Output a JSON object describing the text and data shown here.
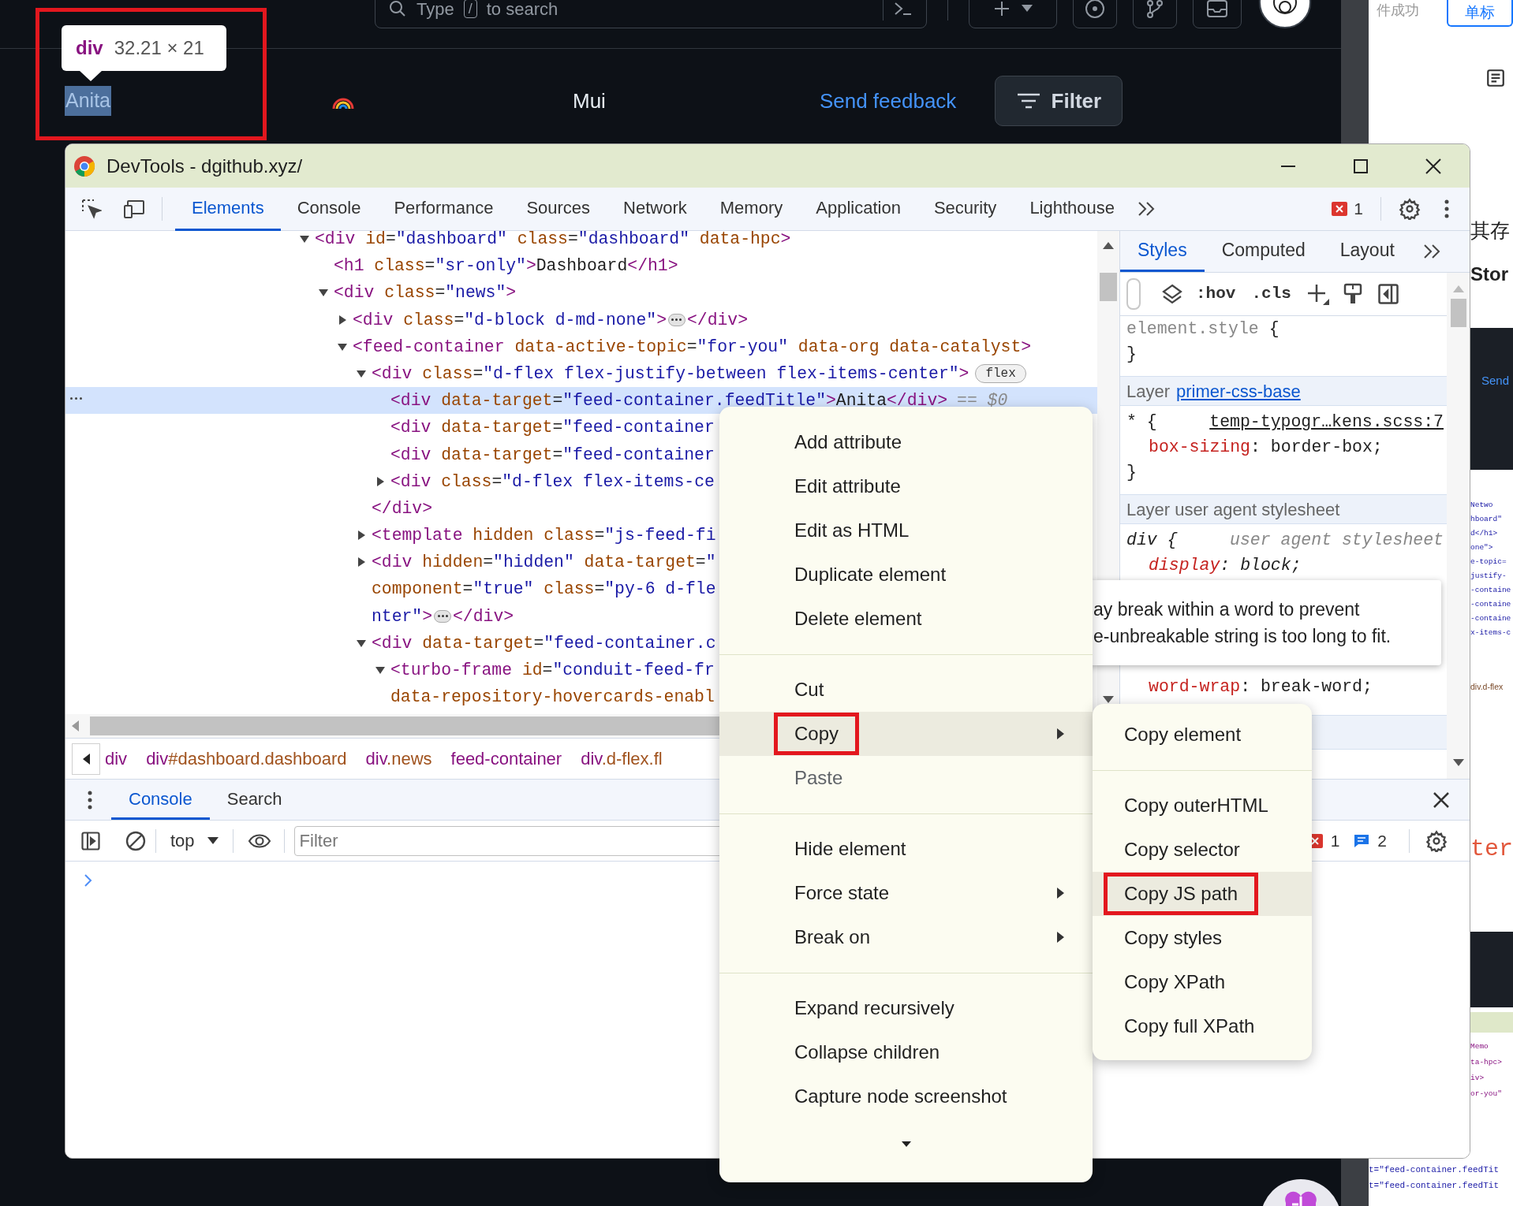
{
  "page": {
    "search": {
      "placeholder": "Type",
      "shortcut_key": "/",
      "placeholder_suffix": "to search"
    },
    "feed_title": {
      "text": "Anita",
      "highlighted": true,
      "annotated": true
    },
    "inspect_tooltip": {
      "tag": "div",
      "size": "32.21 × 21"
    },
    "center_label": "Mui",
    "feedback_link": "Send feedback",
    "filter_button": "Filter"
  },
  "background_page": {
    "top_text": "件成功",
    "top_button": "单标",
    "heading_1": "其存",
    "heading_2": "Stor",
    "link": "Send",
    "code_fragment": "ter",
    "mini_lines_upper": [
      "Netwo",
      "hboard\"",
      "d</h1>",
      "one\">",
      "e-topic=",
      "justify-",
      "-containe",
      "-containe",
      "-containe",
      "x-items-c"
    ],
    "mini_breadcrumb": "div.d-flex",
    "mini_lines_lower": [
      "Memo",
      "ta-hpc>",
      "iv>",
      "or-you\""
    ],
    "mini_lines_bottom": [
      "t=\"feed-container.feedTit",
      "t=\"feed-container.feedTit"
    ]
  },
  "devtools": {
    "title": "DevTools - dgithub.xyz/",
    "tabs": [
      {
        "label": "Elements",
        "selected": true
      },
      {
        "label": "Console",
        "selected": false
      },
      {
        "label": "Performance",
        "selected": false
      },
      {
        "label": "Sources",
        "selected": false
      },
      {
        "label": "Network",
        "selected": false
      },
      {
        "label": "Memory",
        "selected": false
      },
      {
        "label": "Application",
        "selected": false
      },
      {
        "label": "Security",
        "selected": false
      },
      {
        "label": "Lighthouse",
        "selected": false
      }
    ],
    "error_count": "1",
    "dom_tree": [
      {
        "lines": [
          [
            {
              "kind": "tag",
              "text": "<div"
            },
            {
              "kind": "attr",
              "text": " id"
            },
            {
              "kind": "txt",
              "text": "="
            },
            {
              "kind": "val",
              "text": "\"dashboard\""
            },
            {
              "kind": "attr",
              "text": " class"
            },
            {
              "kind": "txt",
              "text": "="
            },
            {
              "kind": "val",
              "text": "\"dashboard\""
            },
            {
              "kind": "attr",
              "text": " data-hpc"
            },
            {
              "kind": "tag",
              "text": ">"
            }
          ]
        ],
        "expanded": true,
        "selected": false,
        "children": [
          {
            "lines": [
              [
                {
                  "kind": "tag",
                  "text": "<h1"
                },
                {
                  "kind": "attr",
                  "text": " class"
                },
                {
                  "kind": "txt",
                  "text": "="
                },
                {
                  "kind": "val",
                  "text": "\"sr-only\""
                },
                {
                  "kind": "tag",
                  "text": ">"
                },
                {
                  "kind": "txt",
                  "text": "Dashboard"
                },
                {
                  "kind": "tag",
                  "text": "</h1>"
                }
              ]
            ],
            "selected": false
          },
          {
            "lines": [
              [
                {
                  "kind": "tag",
                  "text": "<div"
                },
                {
                  "kind": "attr",
                  "text": " class"
                },
                {
                  "kind": "txt",
                  "text": "="
                },
                {
                  "kind": "val",
                  "text": "\"news\""
                },
                {
                  "kind": "tag",
                  "text": ">"
                }
              ]
            ],
            "expanded": true,
            "selected": false,
            "children": [
              {
                "lines": [
                  [
                    {
                      "kind": "tag",
                      "text": "<div"
                    },
                    {
                      "kind": "attr",
                      "text": " class"
                    },
                    {
                      "kind": "txt",
                      "text": "="
                    },
                    {
                      "kind": "val",
                      "text": "\"d-block d-md-none\""
                    },
                    {
                      "kind": "tag",
                      "text": ">"
                    },
                    {
                      "kind": "more"
                    },
                    {
                      "kind": "tag",
                      "text": "</div>"
                    }
                  ]
                ],
                "expanded": false,
                "selected": false
              },
              {
                "lines": [
                  [
                    {
                      "kind": "tag",
                      "text": "<feed-container"
                    },
                    {
                      "kind": "attr",
                      "text": " data-active-topic"
                    },
                    {
                      "kind": "txt",
                      "text": "="
                    },
                    {
                      "kind": "val",
                      "text": "\"for-you\""
                    },
                    {
                      "kind": "attr",
                      "text": " data-org"
                    },
                    {
                      "kind": "attr",
                      "text": " data-catalyst"
                    },
                    {
                      "kind": "tag",
                      "text": ">"
                    }
                  ]
                ],
                "expanded": true,
                "selected": false,
                "children": [
                  {
                    "lines": [
                      [
                        {
                          "kind": "tag",
                          "text": "<div"
                        },
                        {
                          "kind": "attr",
                          "text": " class"
                        },
                        {
                          "kind": "txt",
                          "text": "="
                        },
                        {
                          "kind": "val",
                          "text": "\"d-flex flex-justify-between flex-items-center\""
                        },
                        {
                          "kind": "tag",
                          "text": ">"
                        },
                        {
                          "kind": "badge",
                          "text": "flex"
                        }
                      ]
                    ],
                    "expanded": true,
                    "selected": false,
                    "closing": [
                      {
                        "kind": "tag",
                        "text": "</div>"
                      }
                    ],
                    "children": [
                      {
                        "lines": [
                          [
                            {
                              "kind": "tag",
                              "text": "<div"
                            },
                            {
                              "kind": "attr",
                              "text": " data-target"
                            },
                            {
                              "kind": "txt",
                              "text": "="
                            },
                            {
                              "kind": "val",
                              "text": "\"feed-container.feedTitle\""
                            },
                            {
                              "kind": "tag",
                              "text": ">"
                            },
                            {
                              "kind": "txt",
                              "text": "Anita"
                            },
                            {
                              "kind": "tag",
                              "text": "</div>"
                            },
                            {
                              "kind": "ref",
                              "text": "== $0"
                            }
                          ]
                        ],
                        "selected": true
                      },
                      {
                        "lines": [
                          [
                            {
                              "kind": "tag",
                              "text": "<div"
                            },
                            {
                              "kind": "attr",
                              "text": " data-target"
                            },
                            {
                              "kind": "txt",
                              "text": "="
                            },
                            {
                              "kind": "val",
                              "text": "\"feed-container"
                            }
                          ]
                        ],
                        "selected": false
                      },
                      {
                        "lines": [
                          [
                            {
                              "kind": "tag",
                              "text": "<div"
                            },
                            {
                              "kind": "attr",
                              "text": " data-target"
                            },
                            {
                              "kind": "txt",
                              "text": "="
                            },
                            {
                              "kind": "val",
                              "text": "\"feed-container"
                            }
                          ]
                        ],
                        "selected": false
                      },
                      {
                        "lines": [
                          [
                            {
                              "kind": "tag",
                              "text": "<div"
                            },
                            {
                              "kind": "attr",
                              "text": " class"
                            },
                            {
                              "kind": "txt",
                              "text": "="
                            },
                            {
                              "kind": "val",
                              "text": "\"d-flex flex-items-ce"
                            }
                          ]
                        ],
                        "expanded": false,
                        "selected": false
                      }
                    ]
                  },
                  {
                    "lines": [
                      [
                        {
                          "kind": "tag",
                          "text": "<template"
                        },
                        {
                          "kind": "attr",
                          "text": " hidden"
                        },
                        {
                          "kind": "attr",
                          "text": " class"
                        },
                        {
                          "kind": "txt",
                          "text": "="
                        },
                        {
                          "kind": "val",
                          "text": "\"js-feed-fi"
                        }
                      ]
                    ],
                    "expanded": false,
                    "selected": false
                  },
                  {
                    "lines": [
                      [
                        {
                          "kind": "tag",
                          "text": "<div"
                        },
                        {
                          "kind": "attr",
                          "text": " hidden"
                        },
                        {
                          "kind": "txt",
                          "text": "="
                        },
                        {
                          "kind": "val",
                          "text": "\"hidden\""
                        },
                        {
                          "kind": "attr",
                          "text": " data-target"
                        },
                        {
                          "kind": "txt",
                          "text": "="
                        },
                        {
                          "kind": "val",
                          "text": "\""
                        }
                      ],
                      [
                        {
                          "kind": "attr",
                          "text": "component"
                        },
                        {
                          "kind": "txt",
                          "text": "="
                        },
                        {
                          "kind": "val",
                          "text": "\"true\""
                        },
                        {
                          "kind": "attr",
                          "text": " class"
                        },
                        {
                          "kind": "txt",
                          "text": "="
                        },
                        {
                          "kind": "val",
                          "text": "\"py-6 d-fle"
                        }
                      ],
                      [
                        {
                          "kind": "val",
                          "text": "nter\""
                        },
                        {
                          "kind": "tag",
                          "text": ">"
                        },
                        {
                          "kind": "more"
                        },
                        {
                          "kind": "tag",
                          "text": "</div>"
                        }
                      ]
                    ],
                    "expanded": false,
                    "selected": false
                  },
                  {
                    "lines": [
                      [
                        {
                          "kind": "tag",
                          "text": "<div"
                        },
                        {
                          "kind": "attr",
                          "text": " data-target"
                        },
                        {
                          "kind": "txt",
                          "text": "="
                        },
                        {
                          "kind": "val",
                          "text": "\"feed-container.c"
                        }
                      ]
                    ],
                    "expanded": true,
                    "selected": false,
                    "children": [
                      {
                        "lines": [
                          [
                            {
                              "kind": "tag",
                              "text": "<turbo-frame"
                            },
                            {
                              "kind": "attr",
                              "text": " id"
                            },
                            {
                              "kind": "txt",
                              "text": "="
                            },
                            {
                              "kind": "val",
                              "text": "\"conduit-feed-fr"
                            }
                          ],
                          [
                            {
                              "kind": "attr",
                              "text": "data-repository-hovercards-enabl"
                            }
                          ]
                        ],
                        "expanded": true,
                        "selected": false
                      }
                    ]
                  }
                ]
              }
            ]
          }
        ]
      }
    ],
    "breadcrumbs": [
      {
        "tag": "div"
      },
      {
        "tag": "div",
        "suffix": "#dashboard.dashboard"
      },
      {
        "tag": "div",
        "suffix": ".news"
      },
      {
        "tag": "feed-container"
      },
      {
        "tag": "div",
        "suffix": ".d-flex.fl"
      }
    ],
    "styles_tabs": [
      {
        "label": "Styles",
        "selected": true
      },
      {
        "label": "Computed",
        "selected": false
      },
      {
        "label": "Layout",
        "selected": false
      }
    ],
    "styles_toolbar": {
      "hover_toggle": ":hov",
      "class_toggle": ".cls"
    },
    "rules_upper": [
      {
        "kind": "selector",
        "parts": [
          {
            "kind": "muted",
            "text": "element.style"
          },
          {
            "kind": "plain",
            "text": " {"
          }
        ]
      },
      {
        "kind": "close",
        "text": "}"
      },
      {
        "kind": "layer",
        "label": "Layer",
        "link": "primer-css-base"
      },
      {
        "kind": "selector",
        "parts": [
          {
            "kind": "plain",
            "text": "* {"
          }
        ],
        "source": "temp-typogr…kens.scss:7"
      },
      {
        "kind": "prop",
        "name": "box-sizing",
        "value": ": border-box;"
      },
      {
        "kind": "close",
        "text": "}"
      },
      {
        "kind": "layer",
        "label": "Layer user agent stylesheet"
      },
      {
        "kind": "selector",
        "parts": [
          {
            "kind": "italic",
            "text": "div {"
          }
        ],
        "source_note": "user agent stylesheet"
      },
      {
        "kind": "prop",
        "name": "display",
        "value": ": block;",
        "italic": true
      }
    ],
    "rules_lower": [
      {
        "kind": "prop",
        "name": "word-wrap",
        "value": ": break-word;"
      }
    ],
    "console": {
      "tabs": [
        {
          "label": "Console",
          "selected": true
        },
        {
          "label": "Search",
          "selected": false
        }
      ],
      "context": "top",
      "filter_placeholder": "Filter",
      "errors": "1",
      "messages": "2"
    }
  },
  "style_tooltip": {
    "lines": [
      "ay break within a word to prevent",
      "e-unbreakable string is too long to fit."
    ]
  },
  "context_menu": {
    "items": [
      {
        "kind": "item",
        "label": "Add attribute",
        "selected": false,
        "disabled": false,
        "has_submenu": false,
        "annotated": false
      },
      {
        "kind": "item",
        "label": "Edit attribute",
        "selected": false,
        "disabled": false,
        "has_submenu": false,
        "annotated": false
      },
      {
        "kind": "item",
        "label": "Edit as HTML",
        "selected": false,
        "disabled": false,
        "has_submenu": false,
        "annotated": false
      },
      {
        "kind": "item",
        "label": "Duplicate element",
        "selected": false,
        "disabled": false,
        "has_submenu": false,
        "annotated": false
      },
      {
        "kind": "item",
        "label": "Delete element",
        "selected": false,
        "disabled": false,
        "has_submenu": false,
        "annotated": false
      },
      {
        "kind": "separator"
      },
      {
        "kind": "item",
        "label": "Cut",
        "selected": false,
        "disabled": false,
        "has_submenu": false,
        "annotated": false
      },
      {
        "kind": "item",
        "label": "Copy",
        "selected": true,
        "disabled": false,
        "has_submenu": true,
        "annotated": true
      },
      {
        "kind": "item",
        "label": "Paste",
        "selected": false,
        "disabled": true,
        "has_submenu": false,
        "annotated": false
      },
      {
        "kind": "separator"
      },
      {
        "kind": "item",
        "label": "Hide element",
        "selected": false,
        "disabled": false,
        "has_submenu": false,
        "annotated": false
      },
      {
        "kind": "item",
        "label": "Force state",
        "selected": false,
        "disabled": false,
        "has_submenu": true,
        "annotated": false
      },
      {
        "kind": "item",
        "label": "Break on",
        "selected": false,
        "disabled": false,
        "has_submenu": true,
        "annotated": false
      },
      {
        "kind": "separator"
      },
      {
        "kind": "item",
        "label": "Expand recursively",
        "selected": false,
        "disabled": false,
        "has_submenu": false,
        "annotated": false
      },
      {
        "kind": "item",
        "label": "Collapse children",
        "selected": false,
        "disabled": false,
        "has_submenu": false,
        "annotated": false
      },
      {
        "kind": "item",
        "label": "Capture node screenshot",
        "selected": false,
        "disabled": false,
        "has_submenu": false,
        "annotated": false
      },
      {
        "kind": "scroll_down"
      }
    ]
  },
  "copy_submenu": {
    "items": [
      {
        "kind": "item",
        "label": "Copy element",
        "selected": false,
        "annotated": false
      },
      {
        "kind": "separator"
      },
      {
        "kind": "item",
        "label": "Copy outerHTML",
        "selected": false,
        "annotated": false
      },
      {
        "kind": "item",
        "label": "Copy selector",
        "selected": false,
        "annotated": false
      },
      {
        "kind": "item",
        "label": "Copy JS path",
        "selected": true,
        "annotated": true
      },
      {
        "kind": "item",
        "label": "Copy styles",
        "selected": false,
        "annotated": false
      },
      {
        "kind": "item",
        "label": "Copy XPath",
        "selected": false,
        "annotated": false
      },
      {
        "kind": "item",
        "label": "Copy full XPath",
        "selected": false,
        "annotated": false
      }
    ]
  }
}
